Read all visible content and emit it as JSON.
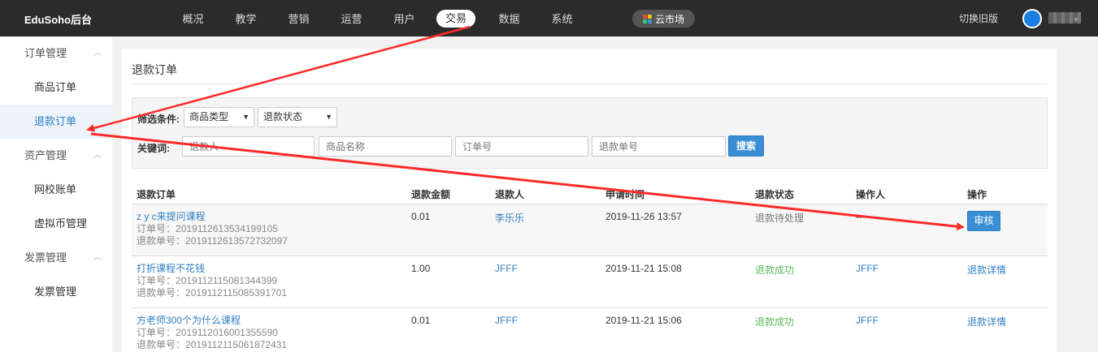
{
  "topbar": {
    "brand": "EduSoho后台",
    "nav": [
      "概况",
      "教学",
      "营销",
      "运营",
      "用户",
      "交易",
      "数据",
      "系统"
    ],
    "active_nav": "交易",
    "market_label": "云市场",
    "switch_old": "切换旧版"
  },
  "sidebar": {
    "groups": [
      {
        "title": "订单管理",
        "items": [
          "商品订单",
          "退款订单"
        ]
      },
      {
        "title": "资产管理",
        "items": [
          "网校账单",
          "虚拟币管理"
        ]
      },
      {
        "title": "发票管理",
        "items": [
          "发票管理"
        ]
      }
    ],
    "active_item": "退款订单"
  },
  "panel": {
    "title": "退款订单",
    "filter": {
      "condition_label": "筛选条件:",
      "select_type": "商品类型",
      "select_status": "退款状态",
      "keyword_label": "关键词:",
      "placeholders": {
        "refund_user": "退款人",
        "product_name": "商品名称",
        "order_no": "订单号",
        "refund_no": "退款单号"
      },
      "search_label": "搜索"
    },
    "table": {
      "headers": [
        "退款订单",
        "退款金额",
        "退款人",
        "申请时间",
        "退款状态",
        "操作人",
        "操作"
      ],
      "order_no_prefix": "订单号：",
      "refund_no_prefix": "退款单号：",
      "rows": [
        {
          "title": "z y c来提问课程",
          "order_no": "2019112613534199105",
          "refund_no": "2019112613572732097",
          "amount": "0.01",
          "user": "李乐乐",
          "time": "2019-11-26 13:57",
          "status": "退款待处理",
          "operator": "--",
          "action": "审核"
        },
        {
          "title": "打折课程不花钱",
          "order_no": "2019112115081344399",
          "refund_no": "2019112115085391701",
          "amount": "1.00",
          "user": "JFFF",
          "time": "2019-11-21 15:08",
          "status": "退款成功",
          "operator": "JFFF",
          "action": "退款详情"
        },
        {
          "title": "方老师300个为什么课程",
          "order_no": "2019112016001355590",
          "refund_no": "2019112115061872431",
          "amount": "0.01",
          "user": "JFFF",
          "time": "2019-11-21 15:06",
          "status": "退款成功",
          "operator": "JFFF",
          "action": "退款详情"
        }
      ]
    }
  },
  "colors": {
    "topbar": "#2b2b2b",
    "accent": "#2f7ec1",
    "success": "#5cb85c",
    "annotation": "#ff2a2a"
  }
}
